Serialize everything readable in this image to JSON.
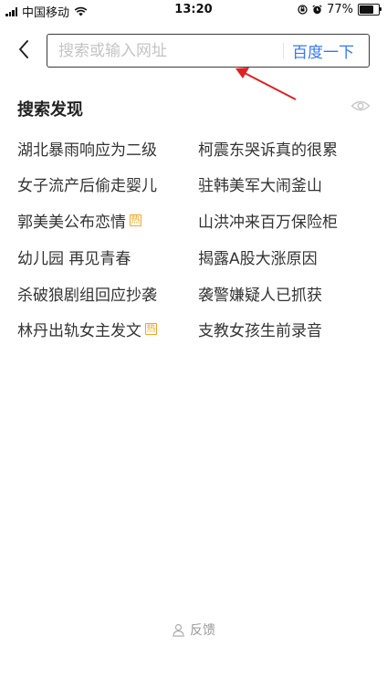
{
  "status_bar": {
    "carrier": "中国移动",
    "time": "13:20",
    "battery_text": "77%",
    "battery_level": 0.77
  },
  "search": {
    "placeholder": "搜索或输入网址",
    "value": "",
    "submit_label": "百度一下"
  },
  "discover": {
    "title": "搜索发现",
    "items": [
      {
        "text": "湖北暴雨响应为二级",
        "hot": false
      },
      {
        "text": "柯震东哭诉真的很累",
        "hot": false
      },
      {
        "text": "女子流产后偷走婴儿",
        "hot": false
      },
      {
        "text": "驻韩美军大闹釜山",
        "hot": false
      },
      {
        "text": "郭美美公布恋情",
        "hot": true
      },
      {
        "text": "山洪冲来百万保险柜",
        "hot": false
      },
      {
        "text": "幼儿园 再见青春",
        "hot": false
      },
      {
        "text": "揭露A股大涨原因",
        "hot": false
      },
      {
        "text": "杀破狼剧组回应抄袭",
        "hot": false
      },
      {
        "text": "袭警嫌疑人已抓获",
        "hot": false
      },
      {
        "text": "林丹出轨女主发文",
        "hot": true
      },
      {
        "text": "支教女孩生前录音",
        "hot": false
      }
    ],
    "hot_badge_label": "热"
  },
  "footer": {
    "feedback_label": "反馈"
  },
  "colors": {
    "accent": "#3478f6",
    "hot": "#f5a623",
    "annotation": "#e02020"
  }
}
